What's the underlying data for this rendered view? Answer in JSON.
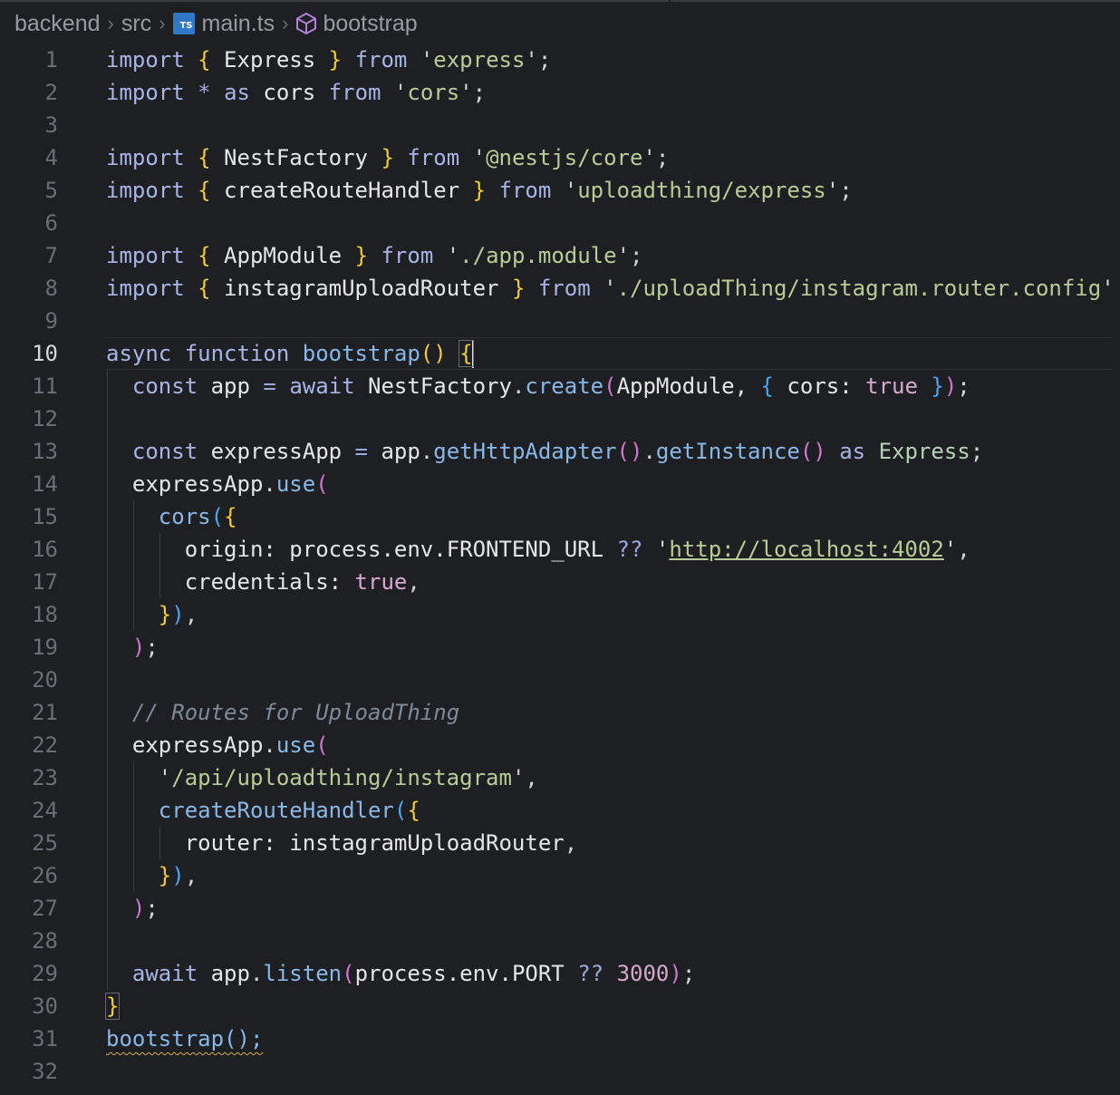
{
  "breadcrumb": {
    "items": [
      "backend",
      "src",
      "main.ts",
      "bootstrap"
    ],
    "icons": [
      "typescript-file-icon",
      "symbol-method-icon"
    ]
  },
  "editor": {
    "current_line": 10,
    "lines": [
      [
        [
          "kw",
          "import"
        ],
        [
          "t",
          " "
        ],
        [
          "br1",
          "{"
        ],
        [
          "id",
          " Express "
        ],
        [
          "br1",
          "}"
        ],
        [
          "t",
          " "
        ],
        [
          "kw",
          "from"
        ],
        [
          "t",
          " "
        ],
        [
          "punc",
          "'"
        ],
        [
          "str",
          "express"
        ],
        [
          "punc",
          "';"
        ]
      ],
      [
        [
          "kw",
          "import"
        ],
        [
          "t",
          " "
        ],
        [
          "op",
          "*"
        ],
        [
          "t",
          " "
        ],
        [
          "kw",
          "as"
        ],
        [
          "id",
          " cors "
        ],
        [
          "kw",
          "from"
        ],
        [
          "t",
          " "
        ],
        [
          "punc",
          "'"
        ],
        [
          "str",
          "cors"
        ],
        [
          "punc",
          "';"
        ]
      ],
      [],
      [
        [
          "kw",
          "import"
        ],
        [
          "t",
          " "
        ],
        [
          "br1",
          "{"
        ],
        [
          "id",
          " NestFactory "
        ],
        [
          "br1",
          "}"
        ],
        [
          "t",
          " "
        ],
        [
          "kw",
          "from"
        ],
        [
          "t",
          " "
        ],
        [
          "punc",
          "'"
        ],
        [
          "str",
          "@nestjs/core"
        ],
        [
          "punc",
          "';"
        ]
      ],
      [
        [
          "kw",
          "import"
        ],
        [
          "t",
          " "
        ],
        [
          "br1",
          "{"
        ],
        [
          "id",
          " createRouteHandler "
        ],
        [
          "br1",
          "}"
        ],
        [
          "t",
          " "
        ],
        [
          "kw",
          "from"
        ],
        [
          "t",
          " "
        ],
        [
          "punc",
          "'"
        ],
        [
          "str",
          "uploadthing/express"
        ],
        [
          "punc",
          "';"
        ]
      ],
      [],
      [
        [
          "kw",
          "import"
        ],
        [
          "t",
          " "
        ],
        [
          "br1",
          "{"
        ],
        [
          "id",
          " AppModule "
        ],
        [
          "br1",
          "}"
        ],
        [
          "t",
          " "
        ],
        [
          "kw",
          "from"
        ],
        [
          "t",
          " "
        ],
        [
          "punc",
          "'"
        ],
        [
          "str",
          "./app.module"
        ],
        [
          "punc",
          "';"
        ]
      ],
      [
        [
          "kw",
          "import"
        ],
        [
          "t",
          " "
        ],
        [
          "br1",
          "{"
        ],
        [
          "id",
          " instagramUploadRouter "
        ],
        [
          "br1",
          "}"
        ],
        [
          "t",
          " "
        ],
        [
          "kw",
          "from"
        ],
        [
          "t",
          " "
        ],
        [
          "punc",
          "'"
        ],
        [
          "str",
          "./uploadThing/instagram.router.config"
        ],
        [
          "punc",
          "'"
        ]
      ],
      [],
      [
        [
          "kw",
          "async"
        ],
        [
          "t",
          " "
        ],
        [
          "kw",
          "function"
        ],
        [
          "t",
          " "
        ],
        [
          "fn",
          "bootstrap"
        ],
        [
          "br1",
          "()"
        ],
        [
          "t",
          " "
        ],
        [
          "br1m",
          "{"
        ],
        [
          "cursor",
          ""
        ]
      ],
      [
        [
          "t",
          "  "
        ],
        [
          "kw",
          "const"
        ],
        [
          "id",
          " app "
        ],
        [
          "op",
          "="
        ],
        [
          "t",
          " "
        ],
        [
          "kw",
          "await"
        ],
        [
          "id",
          " NestFactory"
        ],
        [
          "punc",
          "."
        ],
        [
          "fn",
          "create"
        ],
        [
          "br2",
          "("
        ],
        [
          "id",
          "AppModule, "
        ],
        [
          "br3",
          "{"
        ],
        [
          "id",
          " cors: "
        ],
        [
          "bool",
          "true"
        ],
        [
          "t",
          " "
        ],
        [
          "br3",
          "}"
        ],
        [
          "br2",
          ")"
        ],
        [
          "punc",
          ";"
        ]
      ],
      [],
      [
        [
          "t",
          "  "
        ],
        [
          "kw",
          "const"
        ],
        [
          "id",
          " expressApp "
        ],
        [
          "op",
          "="
        ],
        [
          "id",
          " app"
        ],
        [
          "punc",
          "."
        ],
        [
          "fn",
          "getHttpAdapter"
        ],
        [
          "br2",
          "()"
        ],
        [
          "punc",
          "."
        ],
        [
          "fn",
          "getInstance"
        ],
        [
          "br2",
          "()"
        ],
        [
          "t",
          " "
        ],
        [
          "kw",
          "as"
        ],
        [
          "t",
          " "
        ],
        [
          "typ",
          "Express"
        ],
        [
          "punc",
          ";"
        ]
      ],
      [
        [
          "t",
          "  "
        ],
        [
          "id",
          "expressApp"
        ],
        [
          "punc",
          "."
        ],
        [
          "fn",
          "use"
        ],
        [
          "br2",
          "("
        ]
      ],
      [
        [
          "t",
          "    "
        ],
        [
          "fn",
          "cors"
        ],
        [
          "br3",
          "("
        ],
        [
          "br1",
          "{"
        ]
      ],
      [
        [
          "t",
          "      "
        ],
        [
          "prop",
          "origin: process.env.FRONTEND_URL "
        ],
        [
          "op",
          "??"
        ],
        [
          "t",
          " "
        ],
        [
          "punc",
          "'"
        ],
        [
          "url",
          "http://localhost:4002"
        ],
        [
          "punc",
          "',"
        ]
      ],
      [
        [
          "t",
          "      "
        ],
        [
          "prop",
          "credentials: "
        ],
        [
          "bool",
          "true"
        ],
        [
          "punc",
          ","
        ]
      ],
      [
        [
          "t",
          "    "
        ],
        [
          "br1",
          "}"
        ],
        [
          "br3",
          ")"
        ],
        [
          "punc",
          ","
        ]
      ],
      [
        [
          "t",
          "  "
        ],
        [
          "br2",
          ")"
        ],
        [
          "punc",
          ";"
        ]
      ],
      [],
      [
        [
          "t",
          "  "
        ],
        [
          "cm",
          "// Routes for UploadThing"
        ]
      ],
      [
        [
          "t",
          "  "
        ],
        [
          "id",
          "expressApp"
        ],
        [
          "punc",
          "."
        ],
        [
          "fn",
          "use"
        ],
        [
          "br2",
          "("
        ]
      ],
      [
        [
          "t",
          "    "
        ],
        [
          "punc",
          "'"
        ],
        [
          "str",
          "/api/uploadthing/instagram"
        ],
        [
          "punc",
          "',"
        ]
      ],
      [
        [
          "t",
          "    "
        ],
        [
          "fn",
          "createRouteHandler"
        ],
        [
          "br3",
          "("
        ],
        [
          "br1",
          "{"
        ]
      ],
      [
        [
          "t",
          "      "
        ],
        [
          "prop",
          "router: instagramUploadRouter"
        ],
        [
          "punc",
          ","
        ]
      ],
      [
        [
          "t",
          "    "
        ],
        [
          "br1",
          "}"
        ],
        [
          "br3",
          ")"
        ],
        [
          "punc",
          ","
        ]
      ],
      [
        [
          "t",
          "  "
        ],
        [
          "br2",
          ")"
        ],
        [
          "punc",
          ";"
        ]
      ],
      [],
      [
        [
          "t",
          "  "
        ],
        [
          "kw",
          "await"
        ],
        [
          "id",
          " app"
        ],
        [
          "punc",
          "."
        ],
        [
          "fn",
          "listen"
        ],
        [
          "br2",
          "("
        ],
        [
          "id",
          "process.env.PORT "
        ],
        [
          "op",
          "??"
        ],
        [
          "t",
          " "
        ],
        [
          "num",
          "3000"
        ],
        [
          "br2",
          ")"
        ],
        [
          "punc",
          ";"
        ]
      ],
      [
        [
          "br1m",
          "}"
        ]
      ],
      [
        [
          "sq",
          "bootstrap();"
        ]
      ],
      []
    ]
  }
}
